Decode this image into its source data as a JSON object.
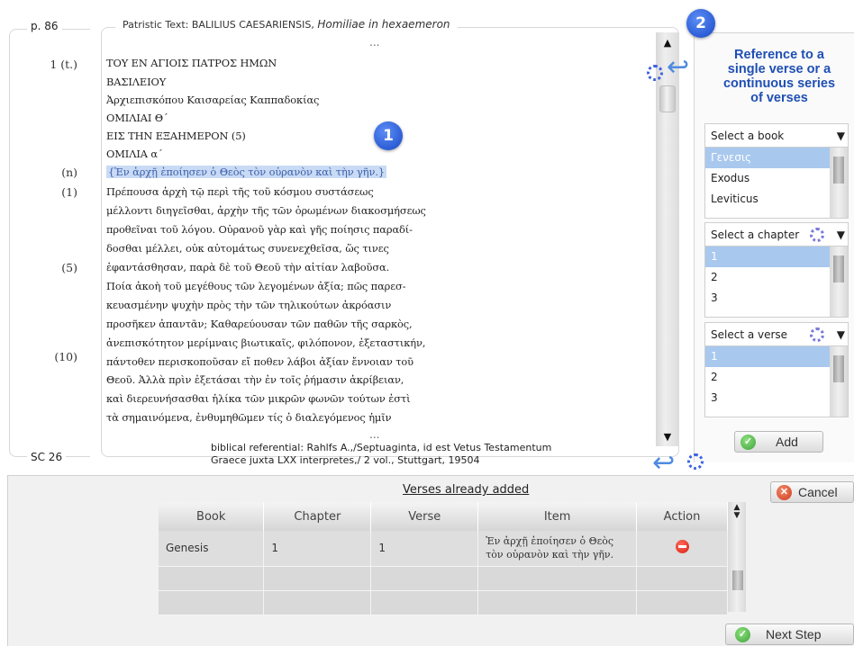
{
  "left_column": {
    "page": "p. 86",
    "footer": "SC 26",
    "line_refs": [
      "1 (t.)",
      "(n)",
      "(1)",
      "(5)",
      "(10)"
    ]
  },
  "text_panel": {
    "header_prefix": "Patristic Text:",
    "author": "BALILIUS CAESARIENSIS,",
    "work": "Homiliae in hexaemeron",
    "ellipsis_top": "...",
    "ellipsis_bottom": "...",
    "lines": [
      "ΤΟΥ ΕΝ ΑΓΙΟΙΣ ΠΑΤΡΟΣ ΗΜΩΝ",
      "ΒΑΣΙΛΕΙΟΥ",
      "Ἀρχιεπισκόπου Καισαρείας Καππαδοκίας",
      "ΟΜΙΛΙΑΙ Θ΄",
      "ΕΙΣ ΤΗΝ ΕΞΑΗΜΕΡΟΝ (5)",
      "ΟΜΙΛΙΑ α΄",
      "{Ἐν ἀρχῇ ἐποίησεν ὁ Θεὸς τὸν οὐρανὸν καὶ τὴν γῆν.}",
      "Πρέπουσα ἀρχὴ τῷ περὶ τῆς τοῦ κόσμου συστάσεως",
      "μέλλοντι διηγεῖσθαι, ἀρχὴν τῆς τῶν ὁρωμένων διακοσμήσεως",
      "προθεῖναι τοῦ λόγου. Οὐρανοῦ γὰρ καὶ γῆς ποίησις παραδί-",
      "δοσθαι μέλλει, οὐκ αὐτομάτως συνενεχθεῖσα, ὥς τινες",
      "ἐφαντάσθησαν, παρὰ δὲ τοῦ Θεοῦ τὴν αἰτίαν λαβοῦσα.",
      "Ποία ἀκοὴ τοῦ μεγέθους τῶν λεγομένων ἀξία; πῶς παρεσ-",
      "κευασμένην ψυχὴν πρὸς τὴν τῶν τηλικούτων ἀκρόασιν",
      "προσῆκεν ἀπαντᾶν; Καθαρεύουσαν τῶν παθῶν τῆς σαρκὸς,",
      "ἀνεπισκότητον μερίμναις βιωτικαῖς, φιλόπονον, ἐξεταστικήν,",
      "πάντοθεν περισκοποῦσαν εἴ ποθεν λάβοι ἀξίαν ἔννοιαν τοῦ",
      "Θεοῦ. Ἀλλὰ πρὶν ἐξετάσαι τὴν ἐν τοῖς ῥήμασιν ἀκρίβειαν,",
      "καὶ διερευνήσασθαι ἡλίκα τῶν μικρῶν φωνῶν τούτων ἐστὶ",
      "τὰ σημαινόμενα, ἐνθυμηθῶμεν τίς ὁ διαλεγόμενος ἡμῖν"
    ],
    "badge": "1"
  },
  "biblio": {
    "line1": "biblical referential: Rahlfs A.,/Septuaginta, id est Vetus Testamentum",
    "line2": "Graece juxta LXX interpretes,/ 2 vol., Stuttgart, 19504"
  },
  "right_panel": {
    "badge": "2",
    "title_lines": [
      "Reference to a",
      "single verse or a",
      "continuous series",
      "of verses"
    ],
    "book_select": {
      "label": "Select a book",
      "options": [
        "Γενεσις",
        "Exodus",
        "Leviticus"
      ]
    },
    "chapter_select": {
      "label": "Select a chapter",
      "options": [
        "1",
        "2",
        "3"
      ]
    },
    "verse_select": {
      "label": "Select a verse",
      "options": [
        "1",
        "2",
        "3"
      ]
    },
    "add_label": "Add"
  },
  "bottom": {
    "title": "Verses already added",
    "cancel_label": "Cancel",
    "next_label": "Next Step",
    "columns": [
      "Book",
      "Chapter",
      "Verse",
      "Item",
      "Action"
    ],
    "rows": [
      {
        "book": "Genesis",
        "chapter": "1",
        "verse": "1",
        "item_line1": "Ἐν ἀρχῇ ἐποίησεν ὁ Θεὸς",
        "item_line2": "τὸν οὐρανὸν καὶ τὴν γῆν."
      }
    ]
  },
  "colors": {
    "accent": "#1f4fb4",
    "selection": "#c9daf5",
    "list_selection": "#a8c8ee"
  }
}
